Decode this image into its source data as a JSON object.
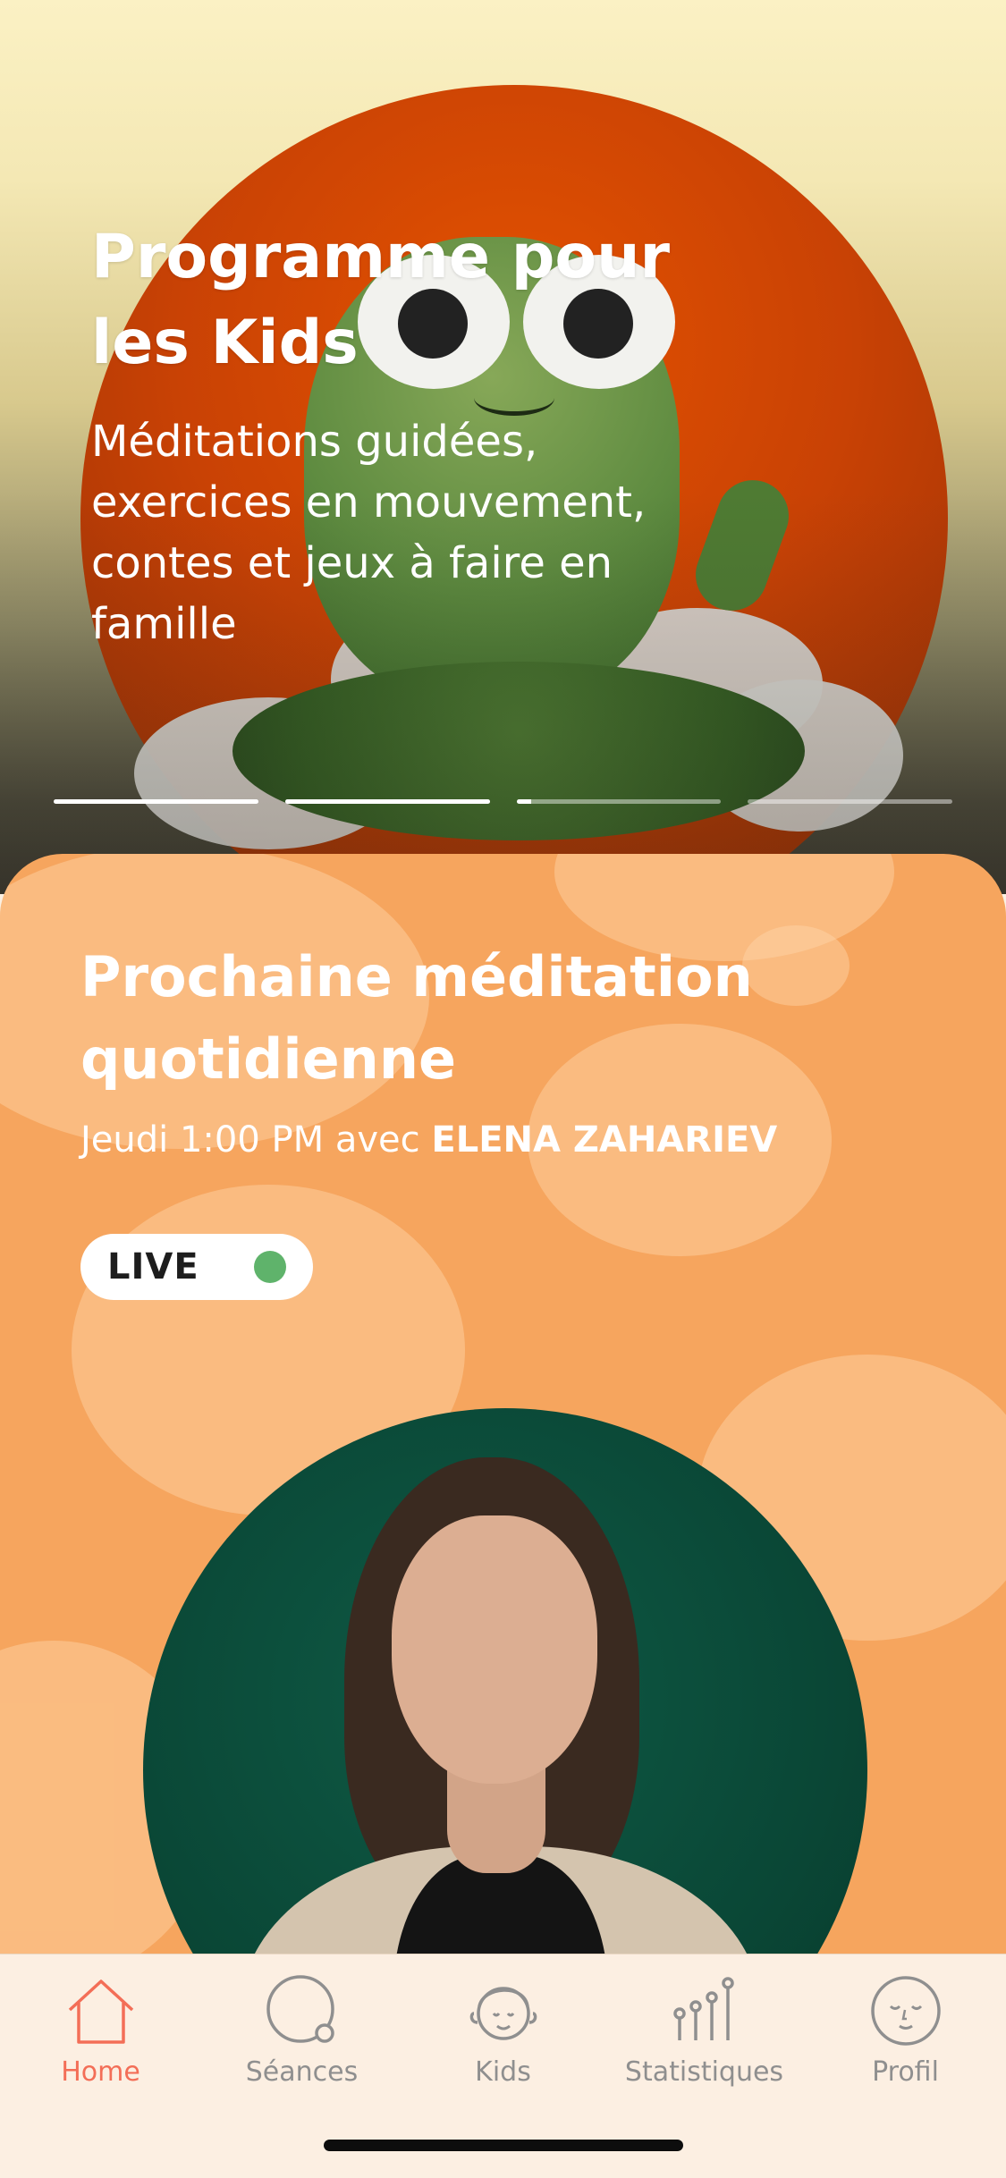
{
  "hero": {
    "title": "Programme pour les Kids",
    "subtitle": "Méditations guidées, exercices en mouvement, contes et jeux à faire en famille",
    "progress": [
      1,
      1,
      0.07,
      0
    ]
  },
  "card": {
    "title": "Prochaine méditation quotidienne",
    "schedule": "Jeudi 1:00 PM avec ",
    "host": "ELENA ZAHARIEV",
    "live_label": "LIVE",
    "live_dot_color": "#5fb36b",
    "accent": "#f6a55e"
  },
  "tabs": [
    {
      "label": "Home",
      "icon": "home-icon",
      "active": true
    },
    {
      "label": "Séances",
      "icon": "sessions-icon",
      "active": false
    },
    {
      "label": "Kids",
      "icon": "kids-icon",
      "active": false
    },
    {
      "label": "Statistiques",
      "icon": "stats-icon",
      "active": false
    },
    {
      "label": "Profil",
      "icon": "profile-icon",
      "active": false
    }
  ],
  "colors": {
    "tab_active": "#f36e57",
    "tab_inactive": "#8f8f8f"
  }
}
